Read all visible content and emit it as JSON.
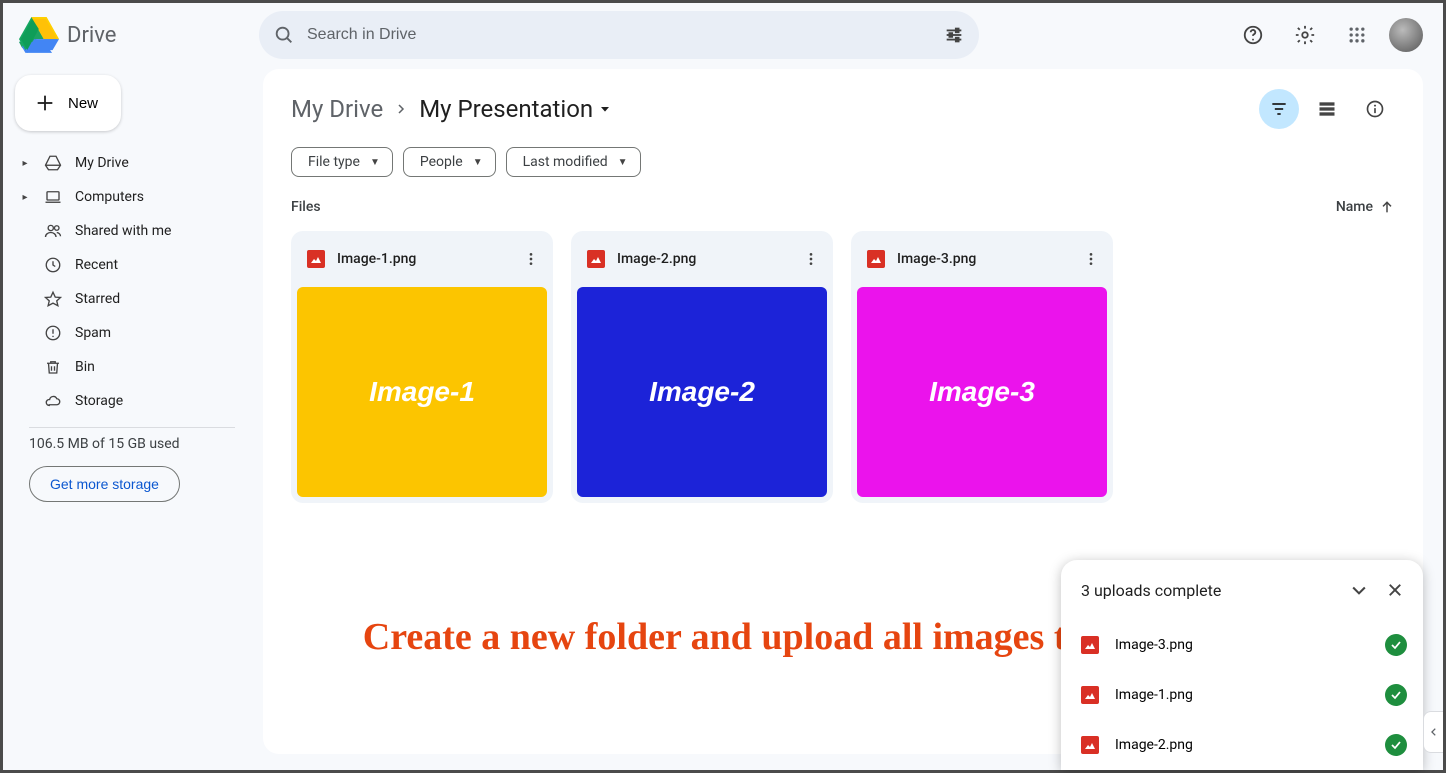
{
  "app": {
    "name": "Drive"
  },
  "search": {
    "placeholder": "Search in Drive"
  },
  "sidebar": {
    "new_label": "New",
    "items": [
      {
        "label": "My Drive",
        "icon": "drive"
      },
      {
        "label": "Computers",
        "icon": "laptop"
      },
      {
        "label": "Shared with me",
        "icon": "people"
      },
      {
        "label": "Recent",
        "icon": "clock"
      },
      {
        "label": "Starred",
        "icon": "star"
      },
      {
        "label": "Spam",
        "icon": "spam"
      },
      {
        "label": "Bin",
        "icon": "trash"
      },
      {
        "label": "Storage",
        "icon": "cloud"
      }
    ],
    "storage_text": "106.5 MB of 15 GB used",
    "storage_cta": "Get more storage"
  },
  "breadcrumb": {
    "root": "My Drive",
    "current": "My Presentation"
  },
  "chips": [
    {
      "label": "File type"
    },
    {
      "label": "People"
    },
    {
      "label": "Last modified"
    }
  ],
  "section": {
    "title": "Files",
    "sort_label": "Name"
  },
  "files": [
    {
      "name": "Image-1.png",
      "thumb_label": "Image-1",
      "class": "t1"
    },
    {
      "name": "Image-2.png",
      "thumb_label": "Image-2",
      "class": "t2"
    },
    {
      "name": "Image-3.png",
      "thumb_label": "Image-3",
      "class": "t3"
    }
  ],
  "upload_panel": {
    "title": "3 uploads complete",
    "items": [
      {
        "name": "Image-3.png"
      },
      {
        "name": "Image-1.png"
      },
      {
        "name": "Image-2.png"
      }
    ]
  },
  "annotation": "Create a new folder and upload all images to it"
}
